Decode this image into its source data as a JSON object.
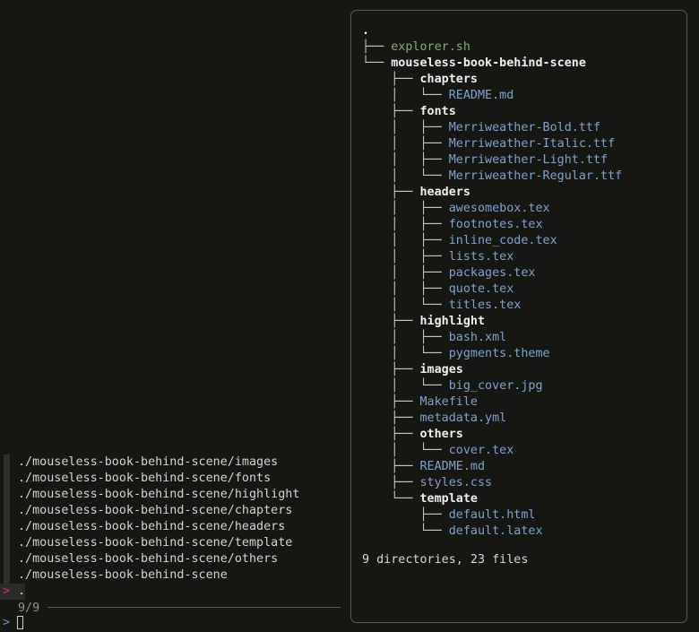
{
  "finder": {
    "results": [
      "./mouseless-book-behind-scene/images",
      "./mouseless-book-behind-scene/fonts",
      "./mouseless-book-behind-scene/highlight",
      "./mouseless-book-behind-scene/chapters",
      "./mouseless-book-behind-scene/headers",
      "./mouseless-book-behind-scene/template",
      "./mouseless-book-behind-scene/others",
      "./mouseless-book-behind-scene"
    ],
    "selected": {
      "marker": ">",
      "text": "."
    },
    "count": "9/9",
    "prompt": ">",
    "query": ""
  },
  "preview": {
    "tree": [
      {
        "prefix": "",
        "name": ".",
        "kind": "root"
      },
      {
        "prefix": "├── ",
        "name": "explorer.sh",
        "kind": "script"
      },
      {
        "prefix": "└── ",
        "name": "mouseless-book-behind-scene",
        "kind": "dir"
      },
      {
        "prefix": "    ├── ",
        "name": "chapters",
        "kind": "dir"
      },
      {
        "prefix": "    │   └── ",
        "name": "README.md",
        "kind": "file"
      },
      {
        "prefix": "    ├── ",
        "name": "fonts",
        "kind": "dir"
      },
      {
        "prefix": "    │   ├── ",
        "name": "Merriweather-Bold.ttf",
        "kind": "file"
      },
      {
        "prefix": "    │   ├── ",
        "name": "Merriweather-Italic.ttf",
        "kind": "file"
      },
      {
        "prefix": "    │   ├── ",
        "name": "Merriweather-Light.ttf",
        "kind": "file"
      },
      {
        "prefix": "    │   └── ",
        "name": "Merriweather-Regular.ttf",
        "kind": "file"
      },
      {
        "prefix": "    ├── ",
        "name": "headers",
        "kind": "dir"
      },
      {
        "prefix": "    │   ├── ",
        "name": "awesomebox.tex",
        "kind": "file"
      },
      {
        "prefix": "    │   ├── ",
        "name": "footnotes.tex",
        "kind": "file"
      },
      {
        "prefix": "    │   ├── ",
        "name": "inline_code.tex",
        "kind": "file"
      },
      {
        "prefix": "    │   ├── ",
        "name": "lists.tex",
        "kind": "file"
      },
      {
        "prefix": "    │   ├── ",
        "name": "packages.tex",
        "kind": "file"
      },
      {
        "prefix": "    │   ├── ",
        "name": "quote.tex",
        "kind": "file"
      },
      {
        "prefix": "    │   └── ",
        "name": "titles.tex",
        "kind": "file"
      },
      {
        "prefix": "    ├── ",
        "name": "highlight",
        "kind": "dir"
      },
      {
        "prefix": "    │   ├── ",
        "name": "bash.xml",
        "kind": "file"
      },
      {
        "prefix": "    │   └── ",
        "name": "pygments.theme",
        "kind": "file"
      },
      {
        "prefix": "    ├── ",
        "name": "images",
        "kind": "dir"
      },
      {
        "prefix": "    │   └── ",
        "name": "big_cover.jpg",
        "kind": "file"
      },
      {
        "prefix": "    ├── ",
        "name": "Makefile",
        "kind": "file"
      },
      {
        "prefix": "    ├── ",
        "name": "metadata.yml",
        "kind": "file"
      },
      {
        "prefix": "    ├── ",
        "name": "others",
        "kind": "dir"
      },
      {
        "prefix": "    │   └── ",
        "name": "cover.tex",
        "kind": "file"
      },
      {
        "prefix": "    ├── ",
        "name": "README.md",
        "kind": "file"
      },
      {
        "prefix": "    ├── ",
        "name": "styles.css",
        "kind": "file"
      },
      {
        "prefix": "    └── ",
        "name": "template",
        "kind": "dir"
      },
      {
        "prefix": "        ├── ",
        "name": "default.html",
        "kind": "file"
      },
      {
        "prefix": "        └── ",
        "name": "default.latex",
        "kind": "file"
      }
    ],
    "summary": "9 directories, 23 files"
  },
  "colors": {
    "background": "#161613",
    "directory": "#f0f0e8",
    "file": "#7fa3cf",
    "script": "#88a972",
    "selection_marker": "#c2236b",
    "prompt": "#6d9bd0",
    "count": "#9a9484"
  }
}
